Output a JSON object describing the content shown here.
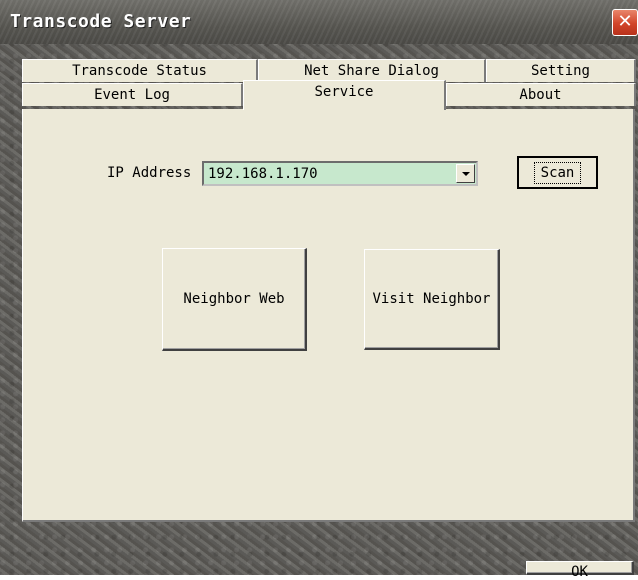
{
  "window": {
    "title": "Transcode Server",
    "close_icon": "close-icon"
  },
  "tabs": {
    "row_back": [
      "Transcode Status",
      "Net Share Dialog",
      "Setting"
    ],
    "row_front": [
      "Event Log",
      "Service",
      "About"
    ],
    "active": "Service"
  },
  "service": {
    "ip_label": "IP Address",
    "ip_value": "192.168.1.170",
    "scan_label": "Scan",
    "neighbor_web_label": "Neighbor Web",
    "visit_neighbor_label": "Visit Neighbor"
  },
  "footer": {
    "ok_label": "OK"
  },
  "colors": {
    "panel": "#ece9d8",
    "ip_field": "#c7e8cd",
    "close": "#d2452a"
  }
}
